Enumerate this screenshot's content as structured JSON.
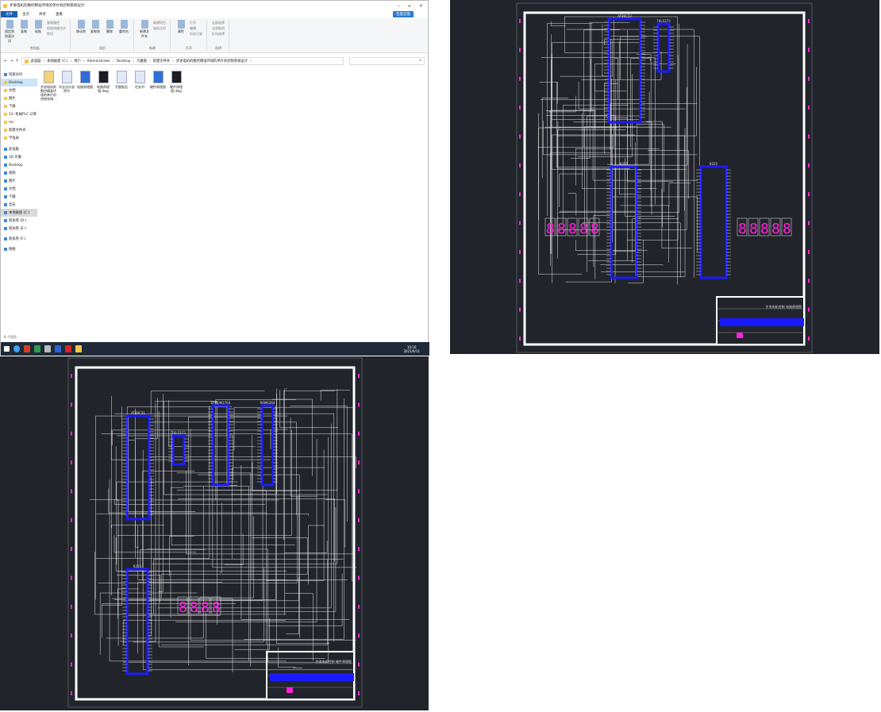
{
  "explorer": {
    "title": "步进电机的数控精准环境的单片机控制系统设计",
    "tabs": [
      "文件",
      "主页",
      "共享",
      "查看"
    ],
    "cloud_button": "百度云盘",
    "ribbon": {
      "groups": [
        {
          "label": "剪贴板",
          "items": [
            "固定到快速访问",
            "复制",
            "粘贴"
          ],
          "small": [
            "复制路径",
            "粘贴快捷方式",
            "剪切"
          ]
        },
        {
          "label": "组织",
          "items": [
            "移动到",
            "复制到",
            "删除",
            "重命名"
          ],
          "small": []
        },
        {
          "label": "新建",
          "items": [
            "新建文件夹"
          ],
          "small": [
            "新建项目",
            "轻松访问"
          ]
        },
        {
          "label": "打开",
          "items": [
            "属性"
          ],
          "small": [
            "打开",
            "编辑",
            "历史记录"
          ]
        },
        {
          "label": "选择",
          "items": [],
          "small": [
            "全部选择",
            "全部取消",
            "反向选择"
          ]
        }
      ]
    },
    "breadcrumb": [
      "此电脑",
      "本地磁盘 (C:)",
      "用户",
      "Administrator",
      "Desktop",
      "凡嘉图",
      "新建文件夹",
      "步进电机的数控精准环境的单片机控制系统设计"
    ],
    "nav": {
      "quick": [
        "快速访问",
        "Desktop",
        "文档",
        "图片",
        "下载",
        "12- 机械PLC (2等",
        "rar",
        "新建文件夹",
        "学电表"
      ],
      "pc": [
        "此电脑",
        "3D 对象",
        "Desktop",
        "视频",
        "图片",
        "文档",
        "下载",
        "音乐",
        "本地磁盘 (C:)",
        "新加卷 (D:)",
        "新加卷 (E:)"
      ],
      "other": [
        "新加卷 (F:)",
        "网络"
      ]
    },
    "files": [
      {
        "name": "步进电机的数控精准环境的单片机控制系统...",
        "type": "folder"
      },
      {
        "name": "毕业设计说明书",
        "type": "word"
      },
      {
        "name": "电路原理图",
        "type": "dwg-word"
      },
      {
        "name": "电路原理图.dwg",
        "type": "dwg"
      },
      {
        "name": "开题报告",
        "type": "word"
      },
      {
        "name": "任务书",
        "type": "word"
      },
      {
        "name": "硬件原理图",
        "type": "dwg-word"
      },
      {
        "name": "硬件原理图.dwg",
        "type": "dwg"
      }
    ],
    "status": "8 个项目",
    "taskbar": {
      "time": "10:16",
      "date": "2021/6/11"
    }
  },
  "cad_right": {
    "chips": [
      "AT89C52",
      "74LS373",
      "8255",
      "8255"
    ],
    "title_block": "步进电机控制 电路原理图"
  },
  "cad_bottom": {
    "chips": [
      "AT89C51",
      "74LS373",
      "EPROM2764",
      "RAM6264",
      "8255"
    ],
    "title_block": "步进电机控制 硬件原理图"
  },
  "colors": {
    "cad_bg": "#21242b",
    "chip": "#1a1aff",
    "seg": "#ff22dd",
    "accent": "#1a5fb4"
  }
}
